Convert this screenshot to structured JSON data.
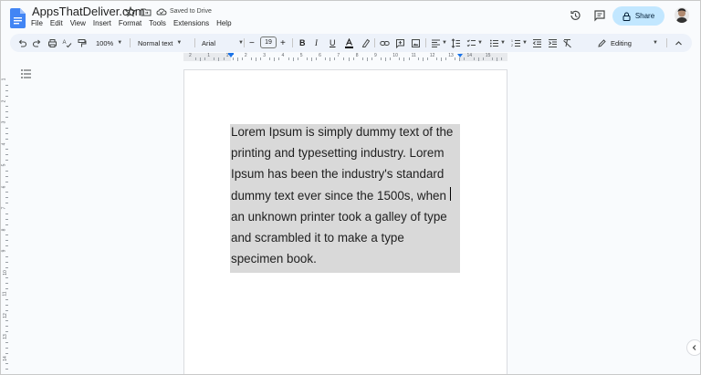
{
  "header": {
    "doc_title": "AppsThatDeliver.com",
    "saved_status": "Saved to Drive",
    "menu": [
      "File",
      "Edit",
      "View",
      "Insert",
      "Format",
      "Tools",
      "Extensions",
      "Help"
    ],
    "share_label": "Share"
  },
  "toolbar": {
    "zoom": "100%",
    "style": "Normal text",
    "font": "Arial",
    "font_size": "19",
    "mode": "Editing"
  },
  "ruler": {
    "labels": [
      "2",
      "1",
      "1",
      "2",
      "3",
      "4",
      "5",
      "6",
      "7",
      "8",
      "9",
      "10",
      "11",
      "12",
      "13",
      "14",
      "15"
    ]
  },
  "vertical_ruler": {
    "labels": [
      "1",
      "2",
      "3",
      "4",
      "5",
      "6",
      "7",
      "8",
      "9",
      "10",
      "11",
      "12",
      "13",
      "14"
    ]
  },
  "document": {
    "lines": [
      "Lorem Ipsum is simply dummy text of the",
      "printing and typesetting industry. Lorem",
      "Ipsum has been the industry's standard",
      "dummy text ever since the 1500s, when",
      "an unknown printer took a galley of type",
      "and scrambled it to make a type",
      "specimen book."
    ]
  },
  "colors": {
    "share_bg": "#c2e7ff",
    "toolbar_bg": "#edf2fa",
    "selection": "#d9d9d9",
    "accent": "#1a73e8"
  }
}
